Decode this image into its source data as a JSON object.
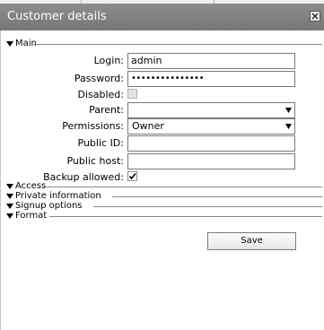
{
  "dialog": {
    "title": "Customer details",
    "close_icon": "close-x-icon"
  },
  "sections": {
    "main": {
      "label": "Main",
      "expanded": true
    },
    "access": {
      "label": "Access",
      "expanded": false
    },
    "private_information": {
      "label": "Private information",
      "expanded": false
    },
    "signup_options": {
      "label": "Signup options",
      "expanded": false
    },
    "format": {
      "label": "Format",
      "expanded": false
    }
  },
  "form": {
    "login": {
      "label": "Login:",
      "value": "admin"
    },
    "password": {
      "label": "Password:",
      "value": "•••••••••••••••"
    },
    "disabled": {
      "label": "Disabled:",
      "checked": false,
      "enabled": false
    },
    "parent": {
      "label": "Parent:",
      "value": ""
    },
    "permissions": {
      "label": "Permissions:",
      "value": "Owner"
    },
    "public_id": {
      "label": "Public ID:",
      "value": ""
    },
    "public_host": {
      "label": "Public host:",
      "value": ""
    },
    "backup_allowed": {
      "label": "Backup allowed:",
      "checked": true
    }
  },
  "actions": {
    "save_label": "Save"
  },
  "colors": {
    "titlebar": "#808080",
    "title_text": "#ffffff",
    "field_border": "#7a7a7a",
    "rule": "#8a8a8a"
  }
}
